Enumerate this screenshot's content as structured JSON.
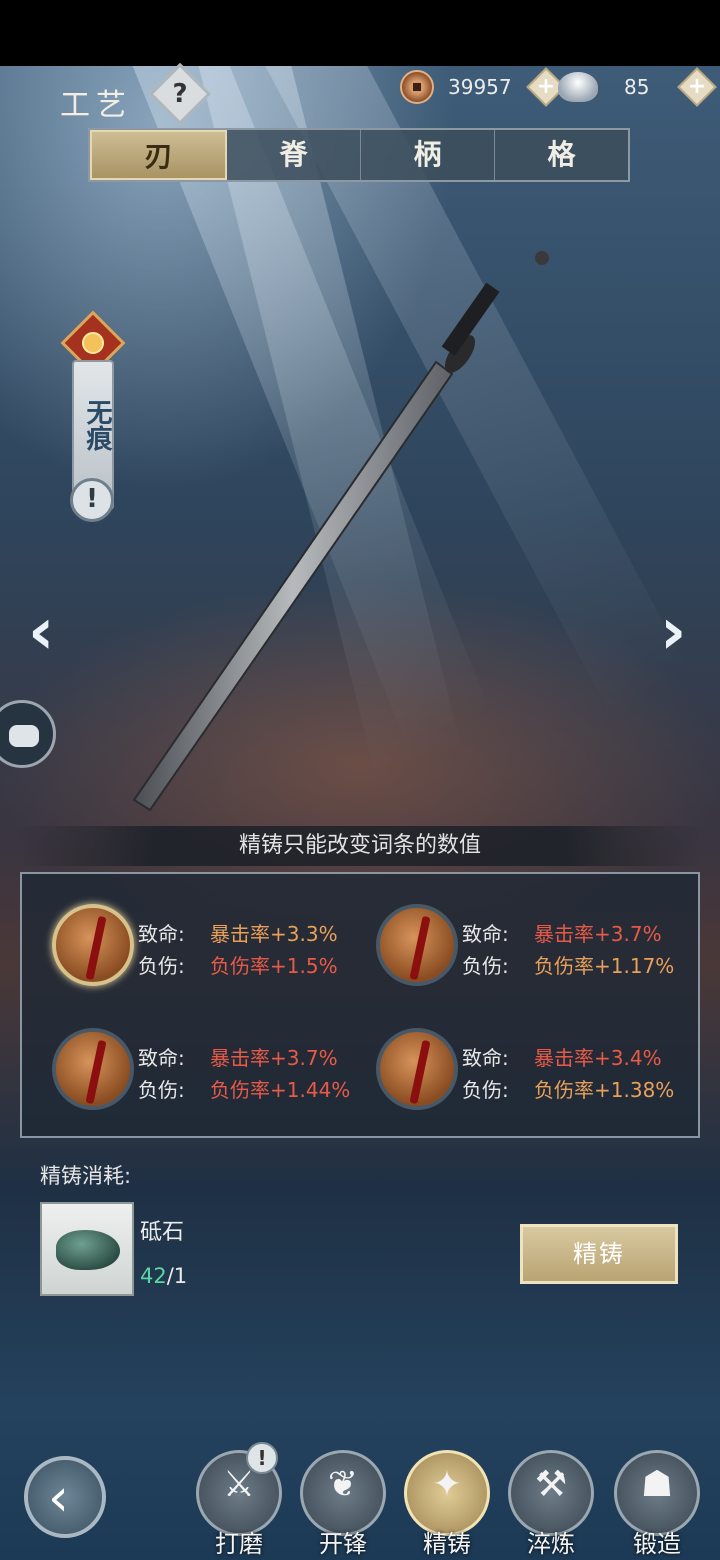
{
  "header": {
    "title": "工艺",
    "help_label": "?",
    "currency": [
      {
        "icon": "copper-coin-icon",
        "value": "39957",
        "add_label": "+"
      },
      {
        "icon": "silver-ingot-icon",
        "value": "85",
        "add_label": "+"
      }
    ]
  },
  "tabs": [
    {
      "label": "刃",
      "active": true
    },
    {
      "label": "脊",
      "active": false
    },
    {
      "label": "柄",
      "active": false
    },
    {
      "label": "格",
      "active": false
    }
  ],
  "weapon": {
    "name": "无痕",
    "warn_label": "!"
  },
  "nav_arrows": {
    "prev": "‹",
    "next": "›"
  },
  "hint": "精铸只能改变词条的数值",
  "affixes": [
    {
      "line1_label": "致命:",
      "line1_value": "暴击率+3.3%",
      "line2_label": "负伤:",
      "line2_value": "负伤率+1.5%",
      "selected": true
    },
    {
      "line1_label": "致命:",
      "line1_value": "暴击率+3.7%",
      "line2_label": "负伤:",
      "line2_value": "负伤率+1.17%",
      "selected": false
    },
    {
      "line1_label": "致命:",
      "line1_value": "暴击率+3.7%",
      "line2_label": "负伤:",
      "line2_value": "负伤率+1.44%",
      "selected": false
    },
    {
      "line1_label": "致命:",
      "line1_value": "暴击率+3.4%",
      "line2_label": "负伤:",
      "line2_value": "负伤率+1.38%",
      "selected": false
    }
  ],
  "cost": {
    "title": "精铸消耗:",
    "item_name": "砥石",
    "have": "42",
    "need": "/1"
  },
  "forge_button": "精铸",
  "bottom_nav": [
    {
      "label": "打磨",
      "icon": "polish-icon",
      "glyph": "⚔",
      "badge": "!",
      "active": false
    },
    {
      "label": "开锋",
      "icon": "sharpen-icon",
      "glyph": "❦",
      "badge": "",
      "active": false
    },
    {
      "label": "精铸",
      "icon": "refine-icon",
      "glyph": "✦",
      "badge": "",
      "active": true
    },
    {
      "label": "淬炼",
      "icon": "temper-icon",
      "glyph": "⚒",
      "badge": "",
      "active": false
    },
    {
      "label": "锻造",
      "icon": "forge-icon",
      "glyph": "☗",
      "badge": "",
      "active": false
    }
  ]
}
